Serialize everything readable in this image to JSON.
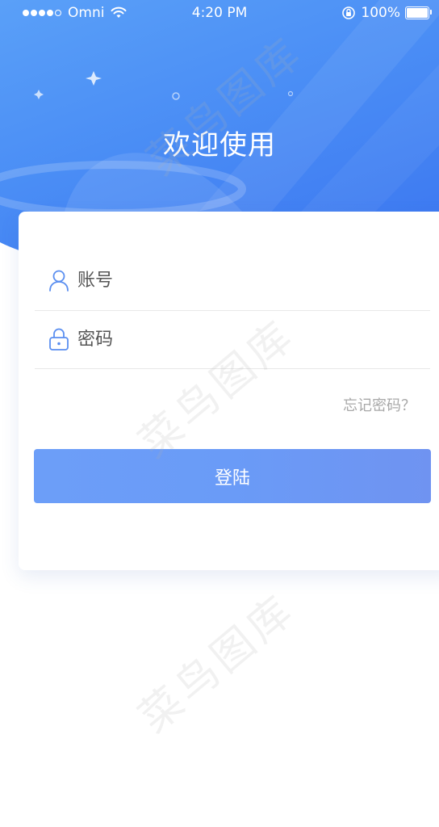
{
  "status_bar": {
    "carrier": "Omni",
    "time": "4:20 PM",
    "battery": "100%"
  },
  "header": {
    "title": "欢迎使用"
  },
  "form": {
    "account_placeholder": "账号",
    "password_placeholder": "密码",
    "forgot_label": "忘记密码？",
    "login_label": "登陆"
  },
  "watermark": {
    "text": "菜鸟图库"
  },
  "colors": {
    "primary": "#4a8df5",
    "button": "#6c9ef8",
    "icon": "#5b8ff0"
  },
  "icons": {
    "account": "user-icon",
    "password": "lock-icon"
  }
}
